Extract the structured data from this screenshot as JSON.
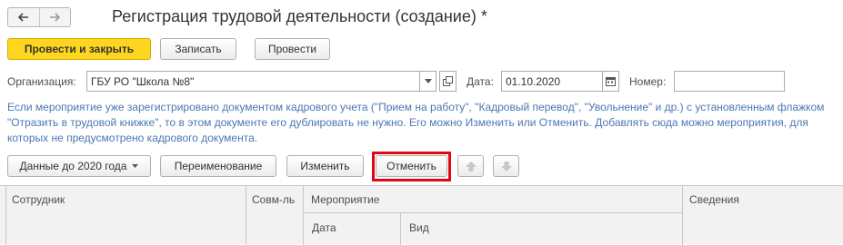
{
  "window": {
    "title": "Регистрация трудовой деятельности (создание) *"
  },
  "nav": {
    "back_icon": "arrow-left-icon",
    "forward_icon": "arrow-right-icon"
  },
  "toolbar": {
    "post_close_label": "Провести и закрыть",
    "save_label": "Записать",
    "post_label": "Провести"
  },
  "form": {
    "org_label": "Организация:",
    "org_value": "ГБУ РО \"Школа №8\"",
    "date_label": "Дата:",
    "date_value": "01.10.2020",
    "number_label": "Номер:",
    "number_value": ""
  },
  "info_text": "Если мероприятие уже зарегистрировано документом кадрового учета (\"Прием на работу\", \"Кадровый перевод\", \"Увольнение\" и др.) с установленным флажком \"Отразить в трудовой книжке\", то в этом документе его дублировать не нужно. Его можно Изменить или Отменить. Добавлять сюда можно мероприятия, для которых не предусмотрено кадрового документа.",
  "table_toolbar": {
    "data_before_label": "Данные до 2020 года",
    "rename_label": "Переименование",
    "change_label": "Изменить",
    "cancel_label": "Отменить"
  },
  "table": {
    "col_employee": "Сотрудник",
    "col_combo": "Совм-ль",
    "col_event": "Мероприятие",
    "col_date": "Дата",
    "col_type": "Вид",
    "col_info": "Сведения"
  },
  "colors": {
    "primary": "#ffd61f",
    "info_text": "#4a78b2",
    "highlight": "#e30613"
  }
}
